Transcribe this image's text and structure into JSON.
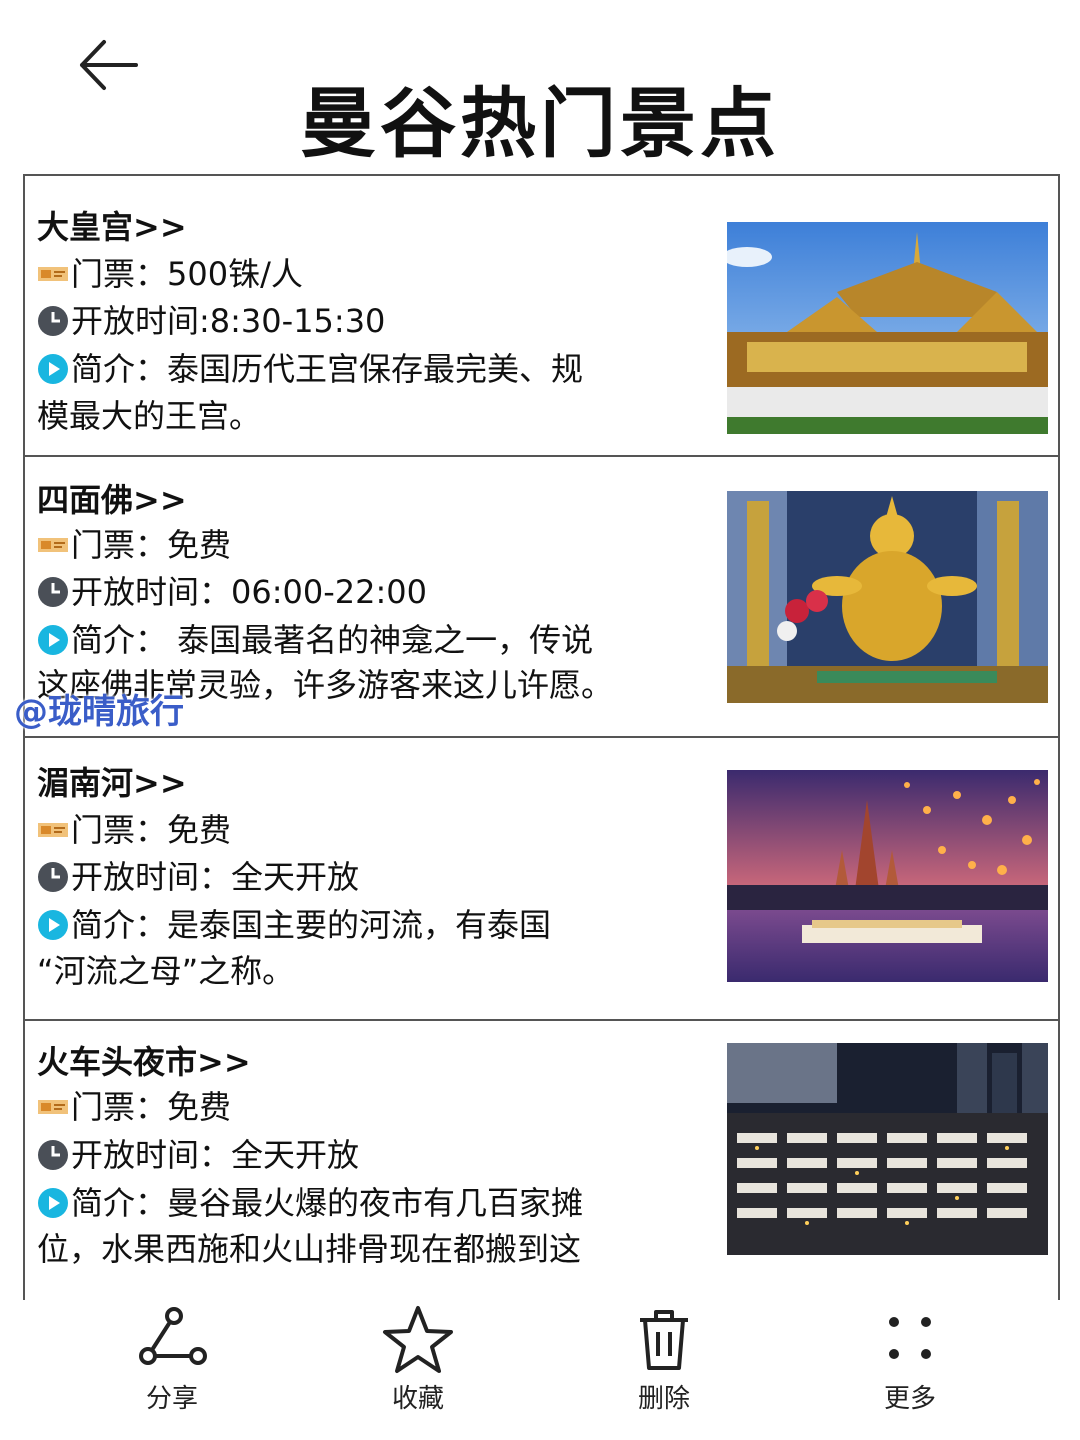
{
  "header": {
    "title": "曼谷热门景点"
  },
  "watermark": "@珑晴旅行",
  "cards": [
    {
      "name": "大皇宫>>",
      "ticket": "门票：500铢/人",
      "hours": "开放时间:8:30-15:30",
      "desc_line1": "简介：泰国历代王宫保存最完美、规",
      "desc_line2": "模最大的王宫。"
    },
    {
      "name": "四面佛>>",
      "ticket": "门票：免费",
      "hours": "开放时间：06:00-22:00",
      "desc_line1": "简介：  泰国最著名的神龛之一，传说",
      "desc_line2": "这座佛非常灵验，许多游客来这儿许愿。"
    },
    {
      "name": "湄南河>>",
      "ticket": "门票：免费",
      "hours": "开放时间：全天开放",
      "desc_line1": "简介：是泰国主要的河流，有泰国",
      "desc_line2": "“河流之母”之称。"
    },
    {
      "name": "火车头夜市>>",
      "ticket": "门票：免费",
      "hours": "开放时间：全天开放",
      "desc_line1": "简介：曼谷最火爆的夜市有几百家摊",
      "desc_line2": "位，水果西施和火山排骨现在都搬到这"
    }
  ],
  "toolbar": {
    "share": "分享",
    "favorite": "收藏",
    "delete": "删除",
    "more": "更多"
  },
  "icons": {
    "ticket": "ticket-icon",
    "clock": "clock-icon",
    "play": "play-circle-icon"
  },
  "colors": {
    "accent_cyan": "#19b6e0",
    "clock_gray": "#4a4f57",
    "ticket_orange": "#e8a43a",
    "border": "#555555"
  }
}
